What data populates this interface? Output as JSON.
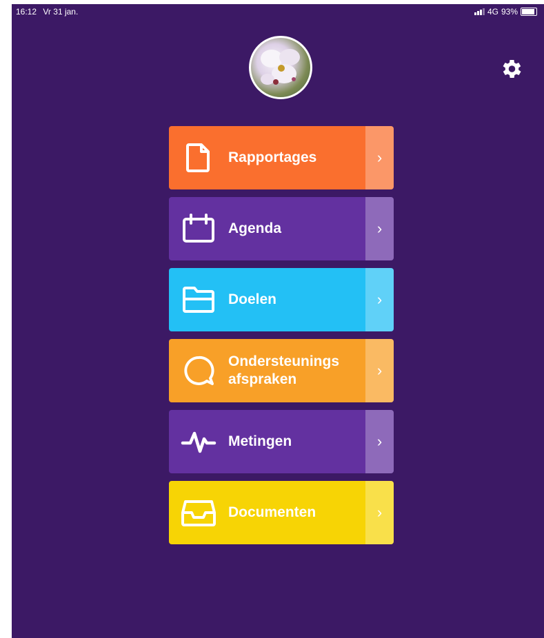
{
  "status_bar": {
    "time": "16:12",
    "date": "Vr 31 jan.",
    "network": "4G",
    "battery": "93%",
    "battery_level": 0.93
  },
  "header": {
    "avatar_icon": "profile-photo-orchid",
    "settings_icon": "gear-icon"
  },
  "menu": {
    "items": [
      {
        "label": "Rapportages",
        "icon": "document-icon",
        "color": "#fa6f2e"
      },
      {
        "label": "Agenda",
        "icon": "calendar-icon",
        "color": "#6331a0"
      },
      {
        "label": "Doelen",
        "icon": "folder-icon",
        "color": "#23c0f5"
      },
      {
        "label": "Ondersteunings afspraken",
        "icon": "chat-bubble-icon",
        "color": "#f8a028"
      },
      {
        "label": "Metingen",
        "icon": "pulse-icon",
        "color": "#6331a0"
      },
      {
        "label": "Documenten",
        "icon": "inbox-tray-icon",
        "color": "#f7d405"
      }
    ],
    "chevron": "›"
  },
  "colors": {
    "background": "#3c1965",
    "text": "#ffffff"
  }
}
